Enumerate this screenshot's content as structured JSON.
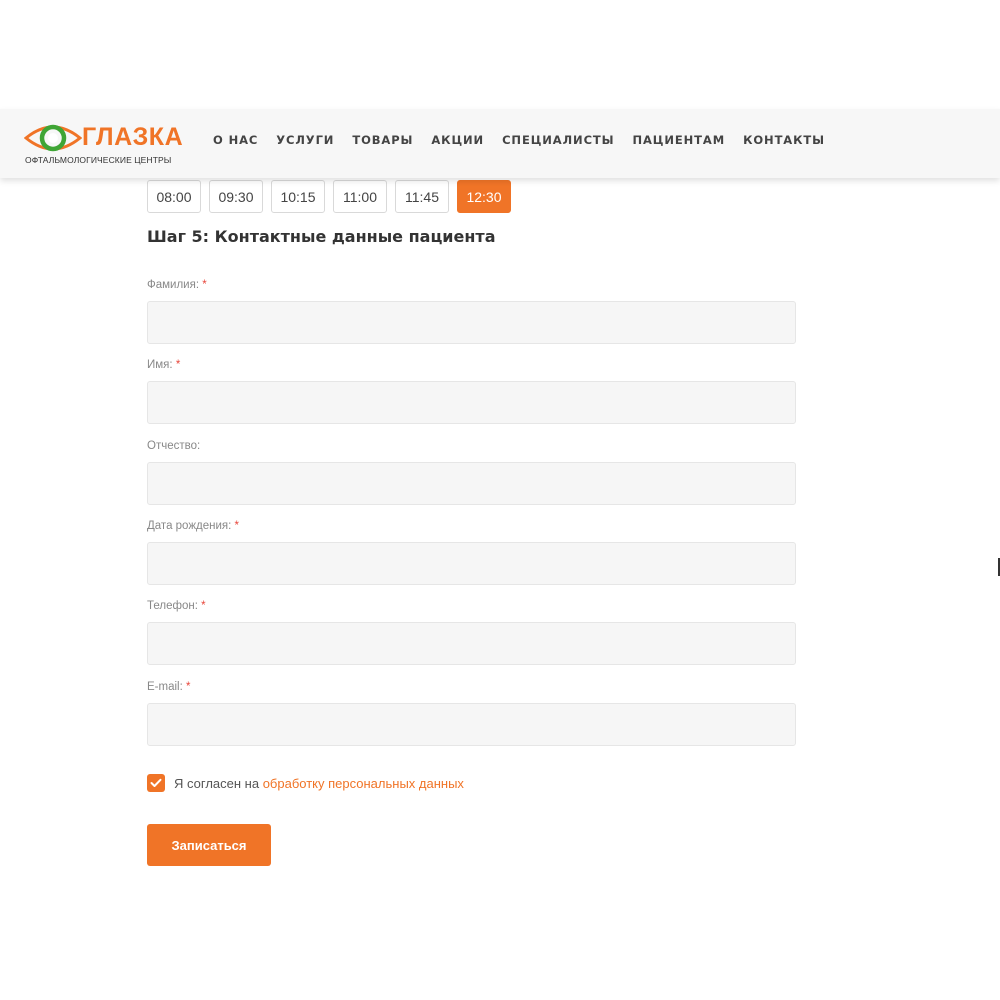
{
  "header": {
    "logo_name": "ГЛАЗКА",
    "logo_subtitle": "ОФТАЛЬМОЛОГИЧЕСКИЕ ЦЕНТРЫ",
    "nav": [
      "О НАС",
      "УСЛУГИ",
      "ТОВАРЫ",
      "АКЦИИ",
      "СПЕЦИАЛИСТЫ",
      "ПАЦИЕНТАМ",
      "КОНТАКТЫ"
    ]
  },
  "time_slots": {
    "items": [
      "08:00",
      "09:30",
      "10:15",
      "11:00",
      "11:45",
      "12:30"
    ],
    "selected": "12:30"
  },
  "step_title": "Шаг 5: Контактные данные пациента",
  "fields": [
    {
      "label": "Фамилия:",
      "required": "*",
      "value": ""
    },
    {
      "label": "Имя:",
      "required": "*",
      "value": ""
    },
    {
      "label": "Отчество:",
      "required": "",
      "value": ""
    },
    {
      "label": "Дата рождения:",
      "required": "*",
      "value": ""
    },
    {
      "label": "Телефон:",
      "required": "*",
      "value": ""
    },
    {
      "label": "E-mail:",
      "required": "*",
      "value": ""
    }
  ],
  "consent": {
    "checked": true,
    "text": "Я согласен на",
    "link": "обработку персональных данных"
  },
  "submit_label": "Записаться",
  "colors": {
    "accent": "#f07427",
    "logo_green": "#3fa535",
    "required": "#e8463b",
    "field_bg": "#f6f6f6"
  }
}
